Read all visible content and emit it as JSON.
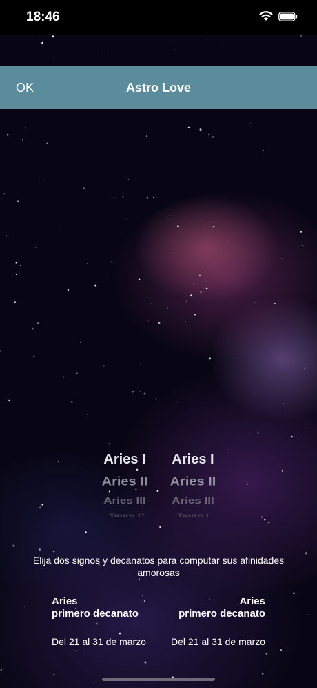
{
  "status_bar": {
    "time": "18:46"
  },
  "navbar": {
    "ok_label": "OK",
    "title": "Astro Love"
  },
  "picker_left": {
    "items": [
      "Aries I",
      "Aries II",
      "Aries III",
      "Tauro I"
    ]
  },
  "picker_right": {
    "items": [
      "Aries I",
      "Aries II",
      "Aries III",
      "Tauro I"
    ]
  },
  "instruction": "Elija dos signos y decanatos para computar sus afinidades amorosas",
  "selection_left": {
    "sign": "Aries",
    "decan": "primero decanato",
    "dates": "Del 21 al 31 de marzo"
  },
  "selection_right": {
    "sign": "Aries",
    "decan": "primero decanato",
    "dates": "Del 21 al 31 de marzo"
  },
  "colors": {
    "navbar": "#5a8c9c",
    "status_bar": "#000000"
  },
  "icons": [
    "wifi-icon",
    "battery-icon"
  ]
}
